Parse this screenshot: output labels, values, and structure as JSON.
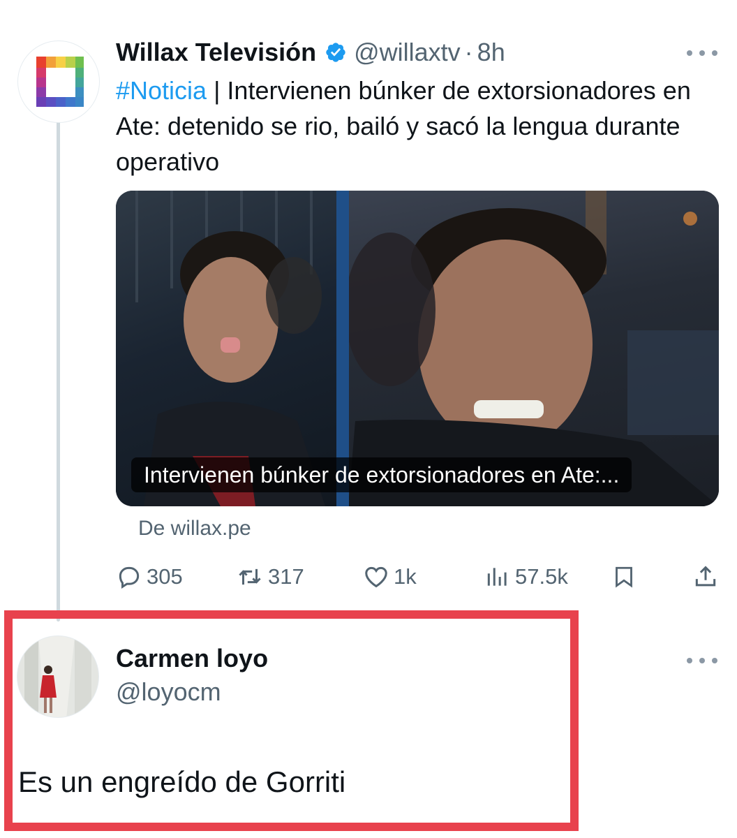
{
  "tweet": {
    "author_name": "Willax Televisión",
    "handle": "@willaxtv",
    "separator": "·",
    "time": "8h",
    "hashtag": "#Noticia",
    "text": " | Intervienen búnker de extorsionadores en Ate: detenido se rio, bailó y sacó la lengua durante operativo",
    "media_caption": "Intervienen búnker de extorsionadores en Ate:...",
    "source": "De willax.pe",
    "stats": {
      "replies": "305",
      "retweets": "317",
      "likes": "1k",
      "views": "57.5k"
    }
  },
  "reply": {
    "author_name": "Carmen loyo",
    "handle": "@loyocm",
    "text": "Es un engreído de Gorriti"
  },
  "colors": {
    "accent": "#1d9bf0",
    "secondary_text": "#536471",
    "highlight_border": "#e8424d",
    "thread_line": "#cfd9de"
  },
  "icons": [
    "verified-badge-icon",
    "more-icon",
    "reply-icon",
    "retweet-icon",
    "like-icon",
    "views-icon",
    "bookmark-icon",
    "share-icon"
  ]
}
